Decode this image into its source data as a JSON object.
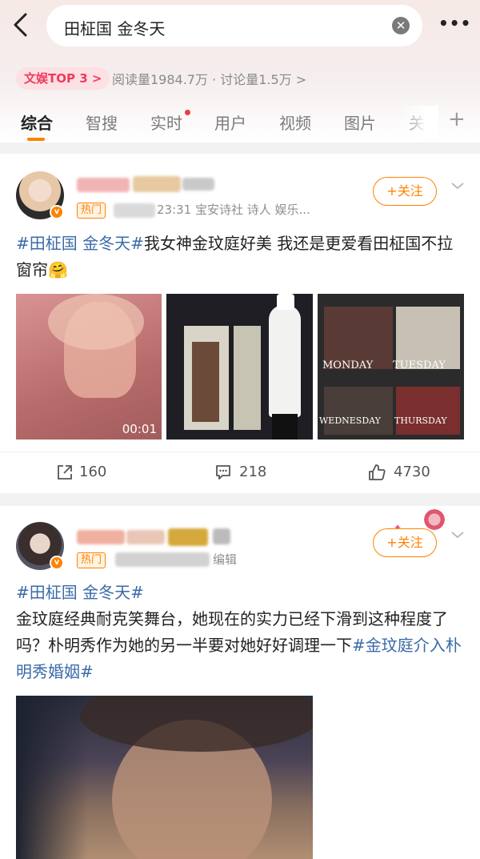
{
  "search": {
    "query": "田柾国 金冬天"
  },
  "topic": {
    "rank_badge": "文娱TOP 3 >",
    "stats": "阅读量1984.7万 · 讨论量1.5万 >"
  },
  "tabs": [
    {
      "label": "综合",
      "active": true
    },
    {
      "label": "智搜"
    },
    {
      "label": "实时"
    },
    {
      "label": "用户"
    },
    {
      "label": "视频"
    },
    {
      "label": "图片"
    },
    {
      "label": "关"
    }
  ],
  "posts": [
    {
      "hot_label": "热门",
      "meta": "23:31  宝安诗社 诗人 娱乐...",
      "follow_label": "+关注",
      "text_tag": "#田柾国 金冬天#",
      "text_body": "我女神金玟庭好美 我还是更爱看田柾国不拉窗帘🤗",
      "video_duration": "00:01",
      "grid_labels": [
        "MONDAY",
        "TUESDAY",
        "WEDNESDAY",
        "THURSDAY"
      ],
      "shares": "160",
      "comments": "218",
      "likes": "4730"
    },
    {
      "hot_label": "热门",
      "meta": "编辑",
      "follow_label": "+关注",
      "text_tag1": "#田柾国 金冬天#",
      "text_body": "金玟庭经典耐克笑舞台，她现在的实力已经下滑到这种程度了吗？朴明秀作为她的另一半要对她好好调理一下",
      "text_tag2": "#金玟庭介入朴明秀婚姻#"
    }
  ],
  "colors": {
    "accent": "#ff8200",
    "topic_link": "#3a6aa8",
    "rank_pink": "#ef3b5c"
  }
}
